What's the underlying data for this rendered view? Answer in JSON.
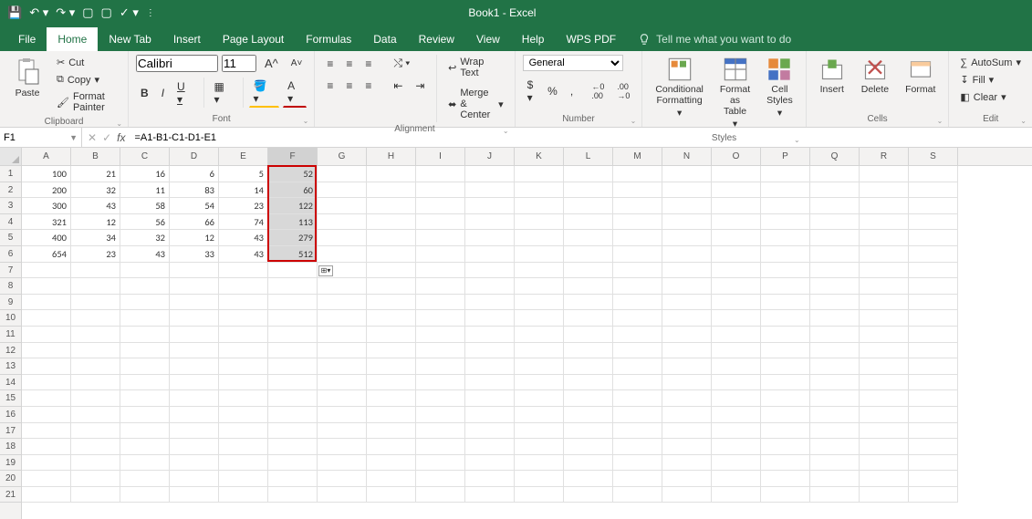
{
  "app": {
    "title": "Book1 - Excel"
  },
  "tabs": [
    "File",
    "Home",
    "New Tab",
    "Insert",
    "Page Layout",
    "Formulas",
    "Data",
    "Review",
    "View",
    "Help",
    "WPS PDF"
  ],
  "active_tab": "Home",
  "tell_me": "Tell me what you want to do",
  "clipboard": {
    "cut": "Cut",
    "copy": "Copy",
    "format_painter": "Format Painter",
    "paste": "Paste",
    "label": "Clipboard"
  },
  "font": {
    "name": "Calibri",
    "size": "11",
    "bold": "B",
    "italic": "I",
    "underline": "U",
    "label": "Font"
  },
  "alignment": {
    "wrap": "Wrap Text",
    "merge": "Merge & Center",
    "label": "Alignment"
  },
  "number": {
    "format": "General",
    "label": "Number"
  },
  "styles": {
    "cond": "Conditional\nFormatting",
    "table": "Format as\nTable",
    "cell": "Cell\nStyles",
    "label": "Styles"
  },
  "cells": {
    "insert": "Insert",
    "delete": "Delete",
    "format": "Format",
    "label": "Cells"
  },
  "editing": {
    "autosum": "AutoSum",
    "fill": "Fill",
    "clear": "Clear",
    "label": "Edit"
  },
  "namebox": "F1",
  "formula": "=A1-B1-C1-D1-E1",
  "columns": [
    "A",
    "B",
    "C",
    "D",
    "E",
    "F",
    "G",
    "H",
    "I",
    "J",
    "K",
    "L",
    "M",
    "N",
    "O",
    "P",
    "Q",
    "R",
    "S"
  ],
  "row_count": 21,
  "grid": [
    [
      "100",
      "21",
      "16",
      "6",
      "5",
      "52"
    ],
    [
      "200",
      "32",
      "11",
      "83",
      "14",
      "60"
    ],
    [
      "300",
      "43",
      "58",
      "54",
      "23",
      "122"
    ],
    [
      "321",
      "12",
      "56",
      "66",
      "74",
      "113"
    ],
    [
      "400",
      "34",
      "32",
      "12",
      "43",
      "279"
    ],
    [
      "654",
      "23",
      "43",
      "33",
      "43",
      "512"
    ]
  ],
  "selected_col_index": 5,
  "selected_rows": [
    0,
    1,
    2,
    3,
    4,
    5
  ],
  "chart_data": {
    "type": "table",
    "columns": [
      "A",
      "B",
      "C",
      "D",
      "E",
      "F"
    ],
    "data": [
      [
        100,
        21,
        16,
        6,
        5,
        52
      ],
      [
        200,
        32,
        11,
        83,
        14,
        60
      ],
      [
        300,
        43,
        58,
        54,
        23,
        122
      ],
      [
        321,
        12,
        56,
        66,
        74,
        113
      ],
      [
        400,
        34,
        32,
        12,
        43,
        279
      ],
      [
        654,
        23,
        43,
        33,
        43,
        512
      ]
    ],
    "note": "Column F = A - B - C - D - E"
  }
}
